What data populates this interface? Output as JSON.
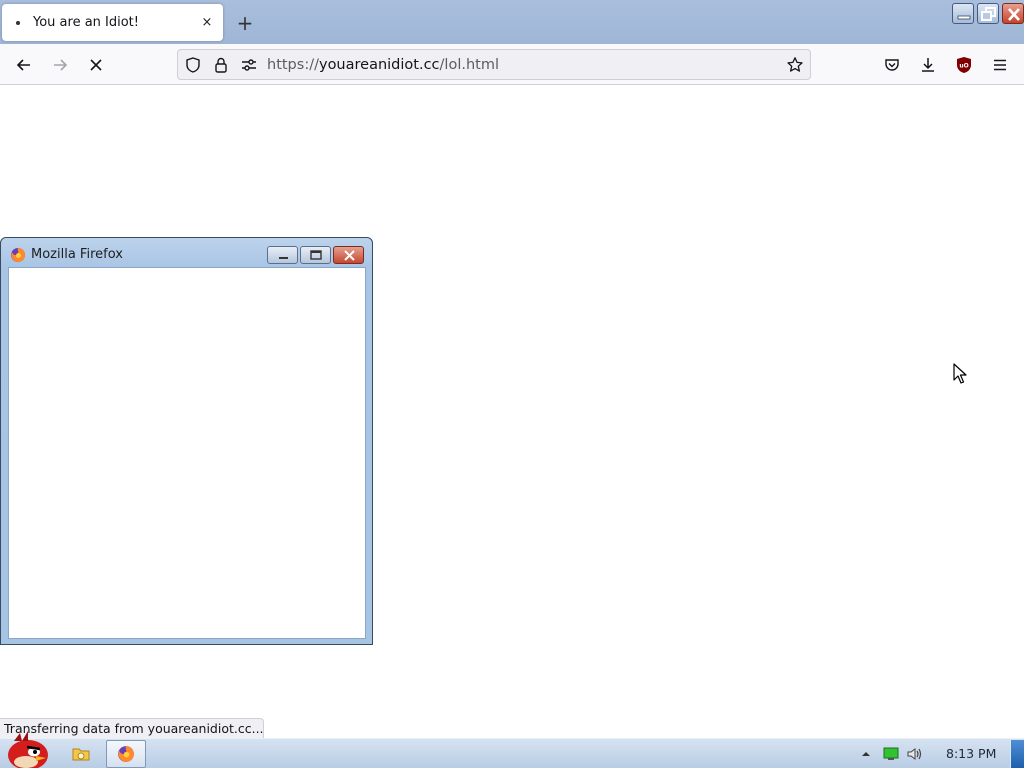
{
  "browser": {
    "tab": {
      "title": "You are an Idiot!",
      "close_glyph": "×"
    },
    "new_tab_glyph": "+",
    "url": {
      "scheme": "https://",
      "domain": "youareanidiot.cc",
      "path": "/lol.html"
    },
    "window_controls": [
      "minimize",
      "restore",
      "close"
    ],
    "icons": {
      "back": "back-arrow-icon",
      "forward": "forward-arrow-icon",
      "stop": "stop-icon",
      "tracking": "shield-icon",
      "lock": "lock-icon",
      "permissions": "permissions-icon",
      "bookmark": "star-icon",
      "pocket": "pocket-icon",
      "downloads": "download-icon",
      "ublock": "ublock-origin-icon",
      "menu": "hamburger-menu-icon"
    },
    "status_text": "Transferring data from youareanidiot.cc..."
  },
  "popup": {
    "title": "Mozilla Firefox",
    "controls": {
      "minimize": "▭",
      "maximize": "▢",
      "close": "✕"
    }
  },
  "taskbar": {
    "clock": "8:13 PM",
    "items": [
      "start-orb",
      "explorer",
      "firefox"
    ],
    "tray": [
      "show-hidden-icons",
      "network-icon",
      "volume-icon"
    ]
  },
  "colors": {
    "tabstrip": "#a9bedc",
    "navbar": "#f9f9fb",
    "taskbar": "#c8d8ec",
    "popup_frame": "#a9c5e5",
    "close_red": "#c2432c"
  }
}
